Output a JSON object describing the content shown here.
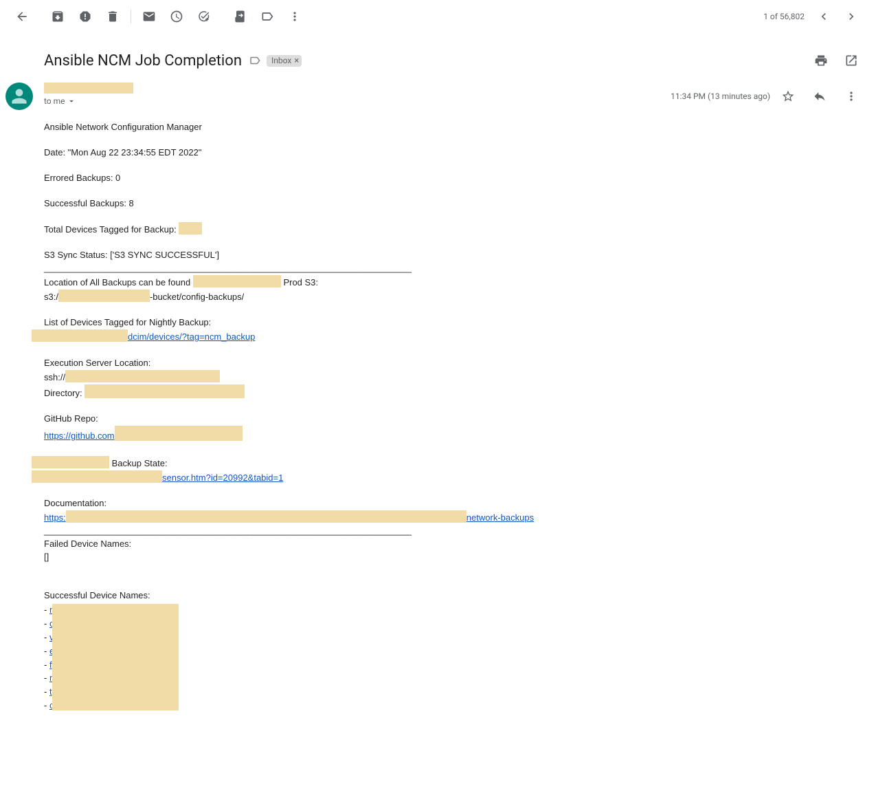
{
  "toolbar": {
    "counter": "1 of 56,802"
  },
  "subject": {
    "text": "Ansible NCM Job Completion",
    "label": "Inbox"
  },
  "sender": {
    "to": "to me",
    "time": "11:34 PM (13 minutes ago)"
  },
  "body": {
    "line1": "Ansible Network Configuration Manager",
    "date": "Date: \"Mon Aug 22 23:34:55 EDT 2022\"",
    "errored": "Errored Backups: 0",
    "successful": "Successful Backups: 8",
    "tagged_prefix": "Total Devices Tagged for Backup: ",
    "s3status": "S3 Sync Status: ['S3 SYNC SUCCESSFUL']",
    "hr": "__________________________________________________________________________",
    "loc_prefix": "Location of All Backups can be found ",
    "loc_suffix": " Prod S3:",
    "s3_prefix": "s3:/",
    "s3_suffix": "-bucket/config-backups/",
    "listdev": "List of Devices Tagged for Nightly Backup:",
    "dcim_link": "dcim/devices/?tag=ncm_backup",
    "exec_loc": "Execution Server Location:",
    "ssh_prefix": "ssh://",
    "dir_label": "Directory: ",
    "gh_label": "GitHub Repo:",
    "gh_link": "https://github.com",
    "backup_state_suffix": " Backup State:",
    "sensor_link": "sensor.htm?id=20992&tabid=1",
    "doc_label": "Documentation:",
    "doc_prefix": "https:",
    "doc_suffix": "network-backups",
    "failed_label": "Failed Device Names:",
    "failed_list": "[]",
    "success_label": "Successful Device Names:",
    "devices": [
      "n",
      "c",
      "v",
      "e",
      "f",
      "n",
      "t",
      "c"
    ]
  }
}
